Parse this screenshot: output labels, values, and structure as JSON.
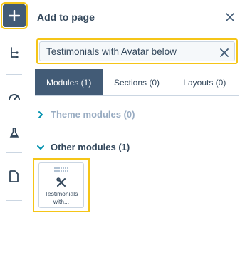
{
  "rail": {
    "items": [
      {
        "name": "add-icon"
      },
      {
        "name": "layout-tree-icon"
      },
      {
        "name": "optimize-gauge-icon"
      },
      {
        "name": "test-flask-icon"
      },
      {
        "name": "page-document-icon"
      }
    ]
  },
  "panel": {
    "title": "Add to page",
    "search": {
      "value": "Testimonials with Avatar below",
      "placeholder": ""
    },
    "tabs": [
      {
        "label": "Modules (1)",
        "active": true
      },
      {
        "label": "Sections (0)",
        "active": false
      },
      {
        "label": "Layouts (0)",
        "active": false
      }
    ],
    "groups": [
      {
        "label": "Theme modules (0)",
        "expanded": false
      },
      {
        "label": "Other modules (1)",
        "expanded": true
      }
    ],
    "modules": [
      {
        "label_line1": "Testimonials",
        "label_line2": "with..."
      }
    ]
  },
  "colors": {
    "accent": "#425b76",
    "highlight": "#f5c518",
    "link": "#0091ae",
    "muted": "#99acc2",
    "text": "#33475b"
  }
}
